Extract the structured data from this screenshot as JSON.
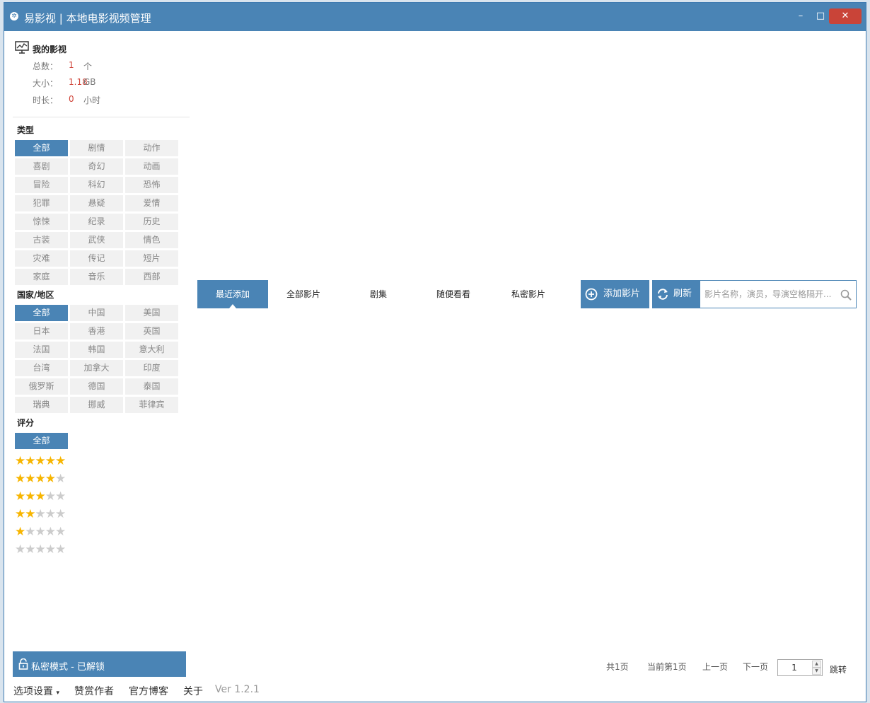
{
  "window": {
    "app_icon": "film-reel-icon",
    "title": "易影视 | 本地电影视频管理",
    "min_glyph": "–",
    "max_glyph": "□",
    "close_glyph": "✕"
  },
  "my_library": {
    "title": "我的影视",
    "icon": "monitor-chart-icon",
    "stats": [
      {
        "label": "总数：",
        "value": "1",
        "unit": "个"
      },
      {
        "label": "大小：",
        "value": "1.18",
        "unit": "GB"
      },
      {
        "label": "时长：",
        "value": "0",
        "unit": "小时"
      }
    ]
  },
  "genre": {
    "title": "类型",
    "items": [
      "全部",
      "剧情",
      "动作",
      "喜剧",
      "奇幻",
      "动画",
      "冒险",
      "科幻",
      "恐怖",
      "犯罪",
      "悬疑",
      "爱情",
      "惊悚",
      "纪录",
      "历史",
      "古装",
      "武侠",
      "情色",
      "灾难",
      "传记",
      "短片",
      "家庭",
      "音乐",
      "西部"
    ],
    "selected": "全部"
  },
  "region": {
    "title": "国家/地区",
    "items": [
      "全部",
      "中国",
      "美国",
      "日本",
      "香港",
      "英国",
      "法国",
      "韩国",
      "意大利",
      "台湾",
      "加拿大",
      "印度",
      "俄罗斯",
      "德国",
      "泰国",
      "瑞典",
      "挪威",
      "菲律宾"
    ],
    "selected": "全部"
  },
  "rating": {
    "title": "评分",
    "all_label": "全部",
    "levels": [
      5,
      4,
      3,
      2,
      1,
      0
    ],
    "max_stars": 5,
    "star_color": "#f7b500",
    "empty_star_color": "#cccccc"
  },
  "private_mode": {
    "icon": "unlock-icon",
    "label": "私密模式 - 已解锁"
  },
  "bottom_menu": {
    "settings": "选项设置",
    "settings_arrow": "▾",
    "donate": "赞赏作者",
    "blog": "官方博客",
    "about": "关于",
    "version": "Ver 1.2.1"
  },
  "tabs": [
    "最近添加",
    "全部影片",
    "剧集",
    "随便看看",
    "私密影片"
  ],
  "active_tab": "最近添加",
  "toolbar": {
    "add_label": "添加影片",
    "add_icon": "plus-circle-icon",
    "refresh_label": "刷新",
    "refresh_icon": "refresh-icon"
  },
  "search": {
    "placeholder": "影片名称，演员，导演空格隔开...",
    "icon": "search-icon"
  },
  "pager": {
    "total": "共1页",
    "current": "当前第1页",
    "prev": "上一页",
    "next": "下一页",
    "page_value": "1",
    "jump": "跳转"
  },
  "colors": {
    "accent": "#4a84b5",
    "close": "#c94438",
    "stat_value": "#d0453a"
  }
}
